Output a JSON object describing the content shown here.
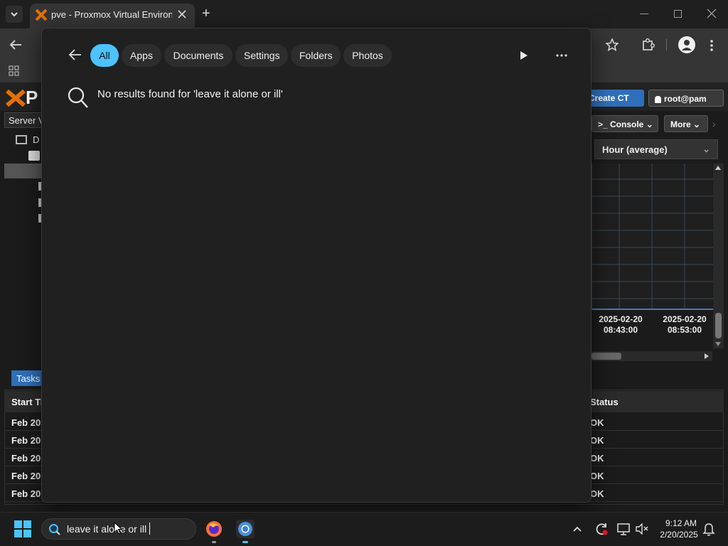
{
  "browser": {
    "tab_title": "pve - Proxmox Virtual Environment",
    "new_tab_symbol": "+"
  },
  "proxmox": {
    "logo_text": "P",
    "create_ct": "Create CT",
    "user": "root@pam",
    "server_view": "Server View",
    "tree_label": "D",
    "console": "Console",
    "more": "More",
    "timeframe": "Hour (average)",
    "times": [
      {
        "date": "2025-02-20",
        "time": "08:43:00"
      },
      {
        "date": "2025-02-20",
        "time": "08:53:00"
      }
    ],
    "tasks_tab": "Tasks",
    "columns": {
      "start": "Start Ti",
      "status": "Status"
    },
    "rows": [
      {
        "start": "Feb 20",
        "status": "OK"
      },
      {
        "start": "Feb 20",
        "status": "OK"
      },
      {
        "start": "Feb 20",
        "status": "OK"
      },
      {
        "start": "Feb 20",
        "status": "OK"
      },
      {
        "start": "Feb 20",
        "status": "OK"
      }
    ]
  },
  "search": {
    "filters": [
      "All",
      "Apps",
      "Documents",
      "Settings",
      "Folders",
      "Photos"
    ],
    "active_filter": "All",
    "no_results": "No results found for 'leave it alone or ill'",
    "accent_color": "#4cc2ff"
  },
  "taskbar": {
    "search_text": "leave it alone or ill",
    "time": "9:12 AM",
    "date": "2/20/2025"
  }
}
